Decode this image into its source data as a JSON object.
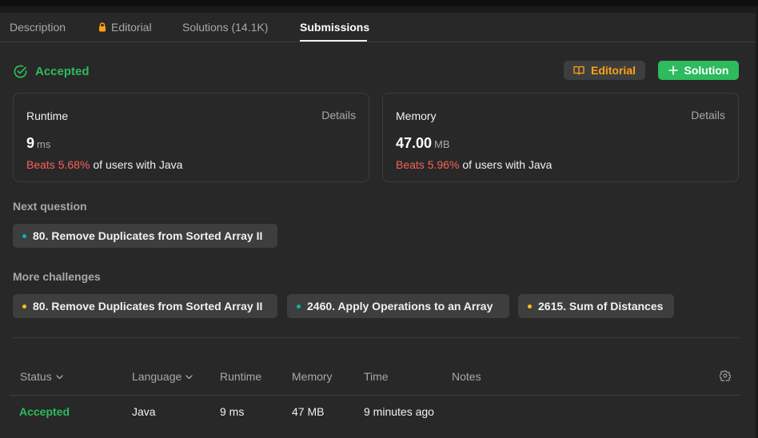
{
  "tabs": [
    {
      "label": "Description",
      "active": false
    },
    {
      "label": "Editorial",
      "active": false,
      "locked": true
    },
    {
      "label": "Solutions (14.1K)",
      "active": false
    },
    {
      "label": "Submissions",
      "active": true
    }
  ],
  "result": {
    "status": "Accepted",
    "editorial_button": "Editorial",
    "solution_button": "Solution"
  },
  "runtime": {
    "label": "Runtime",
    "details": "Details",
    "value": "9",
    "unit": "ms",
    "beats": "Beats 5.68%",
    "beats_suffix": "of users with Java"
  },
  "memory": {
    "label": "Memory",
    "details": "Details",
    "value": "47.00",
    "unit": "MB",
    "beats": "Beats 5.96%",
    "beats_suffix": "of users with Java"
  },
  "next_question": {
    "label": "Next question",
    "items": [
      {
        "title": "80. Remove Duplicates from Sorted Array II",
        "difficulty_color": "#00b8a3"
      }
    ]
  },
  "more_challenges": {
    "label": "More challenges",
    "items": [
      {
        "title": "80. Remove Duplicates from Sorted Array II",
        "difficulty_color": "#ffc01e"
      },
      {
        "title": "2460. Apply Operations to an Array",
        "difficulty_color": "#00b8a3"
      },
      {
        "title": "2615. Sum of Distances",
        "difficulty_color": "#ffc01e"
      }
    ]
  },
  "table": {
    "headers": {
      "status": "Status",
      "language": "Language",
      "runtime": "Runtime",
      "memory": "Memory",
      "time": "Time",
      "notes": "Notes"
    },
    "rows": [
      {
        "status": "Accepted",
        "language": "Java",
        "runtime": "9 ms",
        "memory": "47 MB",
        "time": "9 minutes ago",
        "notes": ""
      }
    ]
  },
  "colors": {
    "accepted": "#2cbb5d",
    "beats": "#f8615c",
    "editorial_accent": "#ffa116",
    "panel": "#282828",
    "easy": "#00b8a3",
    "medium": "#ffc01e"
  },
  "icons": {
    "status": "check-circle-icon",
    "editorial_tab": "lock-icon",
    "editorial_button": "book-icon",
    "solution_button": "plus-icon",
    "settings": "gear-icon",
    "sort": "chevron-down-icon"
  }
}
